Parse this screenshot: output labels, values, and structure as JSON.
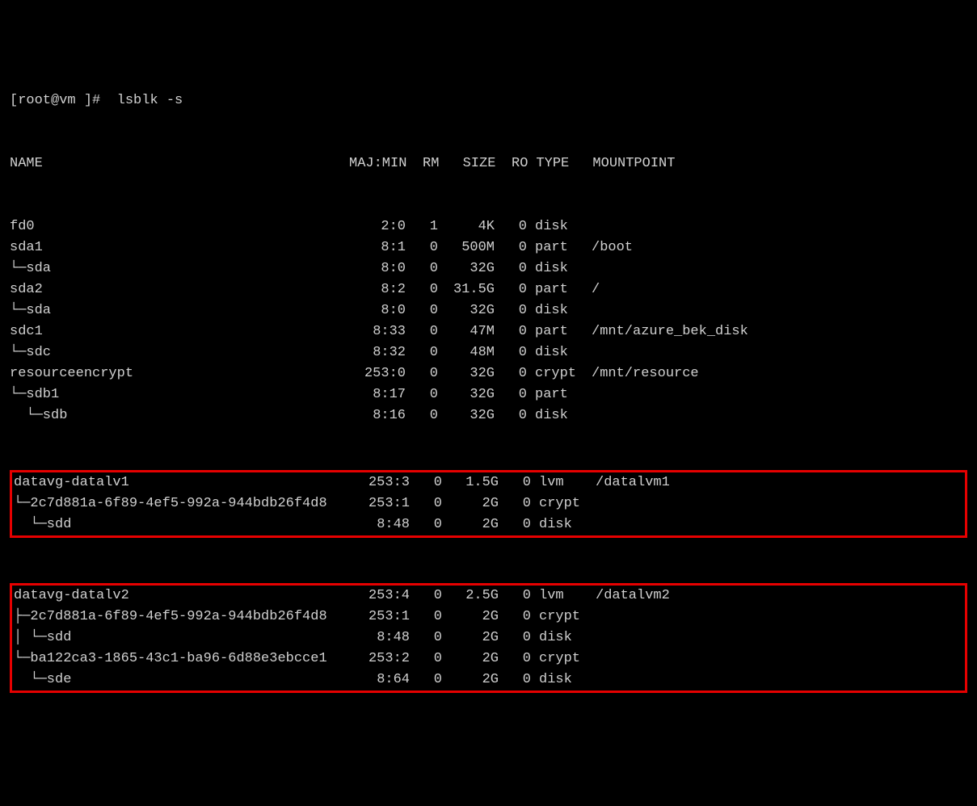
{
  "prompt": {
    "user": "root",
    "host": "vm",
    "cwd": "]",
    "symbol": "#",
    "command": "lsblk -s"
  },
  "header": {
    "name": "NAME",
    "majmin": "MAJ:MIN",
    "rm": "RM",
    "size": "SIZE",
    "ro": "RO",
    "type": "TYPE",
    "mount": "MOUNTPOINT"
  },
  "rows": [
    {
      "name": "fd0",
      "majmin": "2:0",
      "rm": "1",
      "size": "4K",
      "ro": "0",
      "type": "disk",
      "mount": ""
    },
    {
      "name": "sda1",
      "majmin": "8:1",
      "rm": "0",
      "size": "500M",
      "ro": "0",
      "type": "part",
      "mount": "/boot"
    },
    {
      "name": "└─sda",
      "majmin": "8:0",
      "rm": "0",
      "size": "32G",
      "ro": "0",
      "type": "disk",
      "mount": ""
    },
    {
      "name": "sda2",
      "majmin": "8:2",
      "rm": "0",
      "size": "31.5G",
      "ro": "0",
      "type": "part",
      "mount": "/"
    },
    {
      "name": "└─sda",
      "majmin": "8:0",
      "rm": "0",
      "size": "32G",
      "ro": "0",
      "type": "disk",
      "mount": ""
    },
    {
      "name": "sdc1",
      "majmin": "8:33",
      "rm": "0",
      "size": "47M",
      "ro": "0",
      "type": "part",
      "mount": "/mnt/azure_bek_disk"
    },
    {
      "name": "└─sdc",
      "majmin": "8:32",
      "rm": "0",
      "size": "48M",
      "ro": "0",
      "type": "disk",
      "mount": ""
    },
    {
      "name": "resourceencrypt",
      "majmin": "253:0",
      "rm": "0",
      "size": "32G",
      "ro": "0",
      "type": "crypt",
      "mount": "/mnt/resource"
    },
    {
      "name": "└─sdb1",
      "majmin": "8:17",
      "rm": "0",
      "size": "32G",
      "ro": "0",
      "type": "part",
      "mount": ""
    },
    {
      "name": "  └─sdb",
      "majmin": "8:16",
      "rm": "0",
      "size": "32G",
      "ro": "0",
      "type": "disk",
      "mount": ""
    }
  ],
  "box1": [
    {
      "name": "datavg-datalv1",
      "majmin": "253:3",
      "rm": "0",
      "size": "1.5G",
      "ro": "0",
      "type": "lvm",
      "mount": "/datalvm1"
    },
    {
      "name": "└─2c7d881a-6f89-4ef5-992a-944bdb26f4d8",
      "majmin": "253:1",
      "rm": "0",
      "size": "2G",
      "ro": "0",
      "type": "crypt",
      "mount": ""
    },
    {
      "name": "  └─sdd",
      "majmin": "8:48",
      "rm": "0",
      "size": "2G",
      "ro": "0",
      "type": "disk",
      "mount": ""
    }
  ],
  "box2": [
    {
      "name": "datavg-datalv2",
      "majmin": "253:4",
      "rm": "0",
      "size": "2.5G",
      "ro": "0",
      "type": "lvm",
      "mount": "/datalvm2"
    },
    {
      "name": "├─2c7d881a-6f89-4ef5-992a-944bdb26f4d8",
      "majmin": "253:1",
      "rm": "0",
      "size": "2G",
      "ro": "0",
      "type": "crypt",
      "mount": ""
    },
    {
      "name": "│ └─sdd",
      "majmin": "8:48",
      "rm": "0",
      "size": "2G",
      "ro": "0",
      "type": "disk",
      "mount": ""
    },
    {
      "name": "└─ba122ca3-1865-43c1-ba96-6d88e3ebcce1",
      "majmin": "253:2",
      "rm": "0",
      "size": "2G",
      "ro": "0",
      "type": "crypt",
      "mount": ""
    },
    {
      "name": "  └─sde",
      "majmin": "8:64",
      "rm": "0",
      "size": "2G",
      "ro": "0",
      "type": "disk",
      "mount": ""
    }
  ]
}
